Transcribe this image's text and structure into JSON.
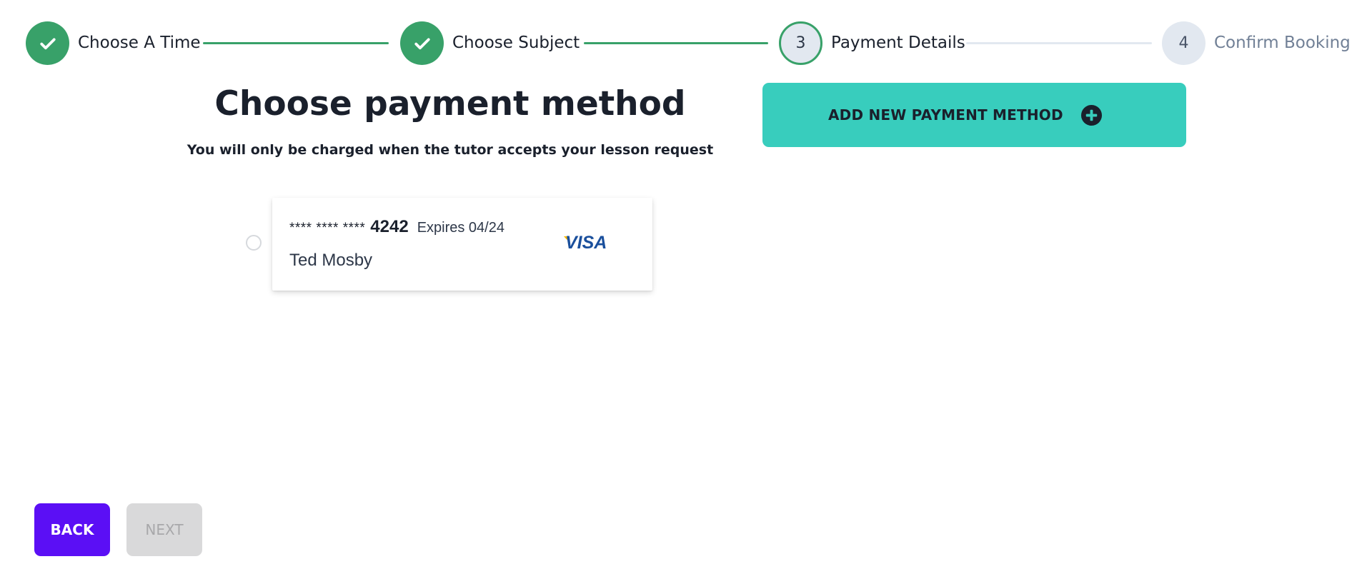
{
  "stepper": {
    "steps": [
      {
        "number": "1",
        "label": "Choose A Time",
        "state": "done"
      },
      {
        "number": "2",
        "label": "Choose Subject",
        "state": "done"
      },
      {
        "number": "3",
        "label": "Payment Details",
        "state": "active"
      },
      {
        "number": "4",
        "label": "Confirm Booking",
        "state": "pending"
      }
    ],
    "colors": {
      "done": "#38a169",
      "pending": "#e2e8f0"
    }
  },
  "main": {
    "title": "Choose payment method",
    "subtitle": "You will only be charged when the tutor accepts your lesson request"
  },
  "add_payment": {
    "label": "ADD NEW PAYMENT METHOD",
    "icon": "plus-circle-icon",
    "color": "#38cdbd"
  },
  "payment_methods": [
    {
      "masked_number": "**** **** ****",
      "last4": "4242",
      "expiry": "Expires 04/24",
      "holder": "Ted Mosby",
      "brand": "VISA",
      "selected": false
    }
  ],
  "footer": {
    "back_label": "BACK",
    "next_label": "NEXT",
    "back_color": "#5b0ff5",
    "next_disabled": true
  }
}
